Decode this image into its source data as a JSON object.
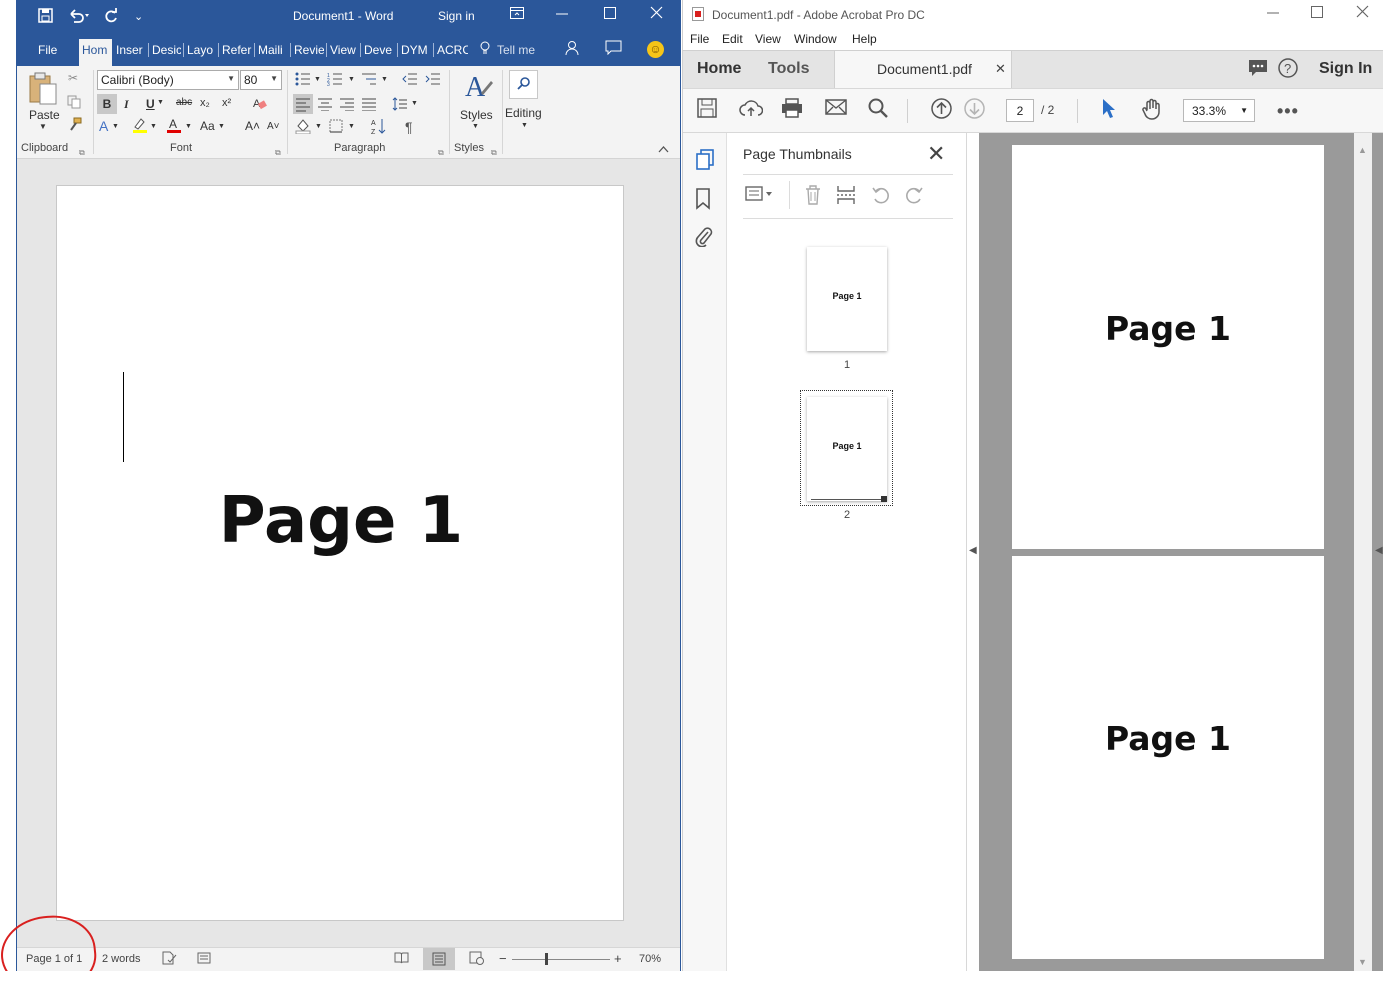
{
  "word": {
    "title": "Document1  -  Word",
    "sign_in": "Sign in",
    "quick_access": {
      "save_icon": "save-icon",
      "undo_icon": "undo-icon",
      "redo_icon": "redo-icon",
      "customize_icon": "customize-icon"
    },
    "tabs": [
      "File",
      "Hom",
      "Inser",
      "Desic",
      "Layo",
      "Refer",
      "Maili",
      "Revie",
      "View",
      "Deve",
      "DYM",
      "ACRC"
    ],
    "active_tab": "Hom",
    "tell_me": "Tell me",
    "ribbon": {
      "paste_label": "Paste",
      "font_name": "Calibri (Body)",
      "font_size": "80",
      "styles_label": "Styles",
      "editing_label": "Editing",
      "groups": {
        "clipboard": "Clipboard",
        "font": "Font",
        "paragraph": "Paragraph",
        "styles": "Styles"
      },
      "format_buttons": {
        "bold": "B",
        "italic": "I",
        "underline": "U",
        "strike": "abc",
        "sub": "x₂",
        "sup": "x²"
      },
      "font_buttons": {
        "change_case": "Aa",
        "grow": "A˄",
        "shrink": "A˅"
      },
      "pilcrow": "¶"
    },
    "document": {
      "body_text": "Page 1"
    },
    "status": {
      "page": "Page 1 of 1",
      "words": "2 words",
      "zoom": "70%",
      "zoom_minus": "−",
      "zoom_plus": "+"
    },
    "annotation_color": "#d9201f",
    "accent": "#2b579a"
  },
  "acrobat": {
    "title": "Document1.pdf - Adobe Acrobat Pro DC",
    "menu": [
      "File",
      "Edit",
      "View",
      "Window",
      "Help"
    ],
    "tabs": {
      "home": "Home",
      "tools": "Tools",
      "document": "Document1.pdf",
      "sign_in": "Sign In"
    },
    "toolbar": {
      "current_page": "2",
      "page_total": "/  2",
      "zoom": "33.3%"
    },
    "panel": {
      "title": "Page Thumbnails"
    },
    "thumbnails": [
      {
        "label": "Page 1",
        "number": "1"
      },
      {
        "label": "Page 1",
        "number": "2"
      }
    ],
    "pages": [
      {
        "text": "Page 1"
      },
      {
        "text": "Page 1"
      }
    ]
  }
}
